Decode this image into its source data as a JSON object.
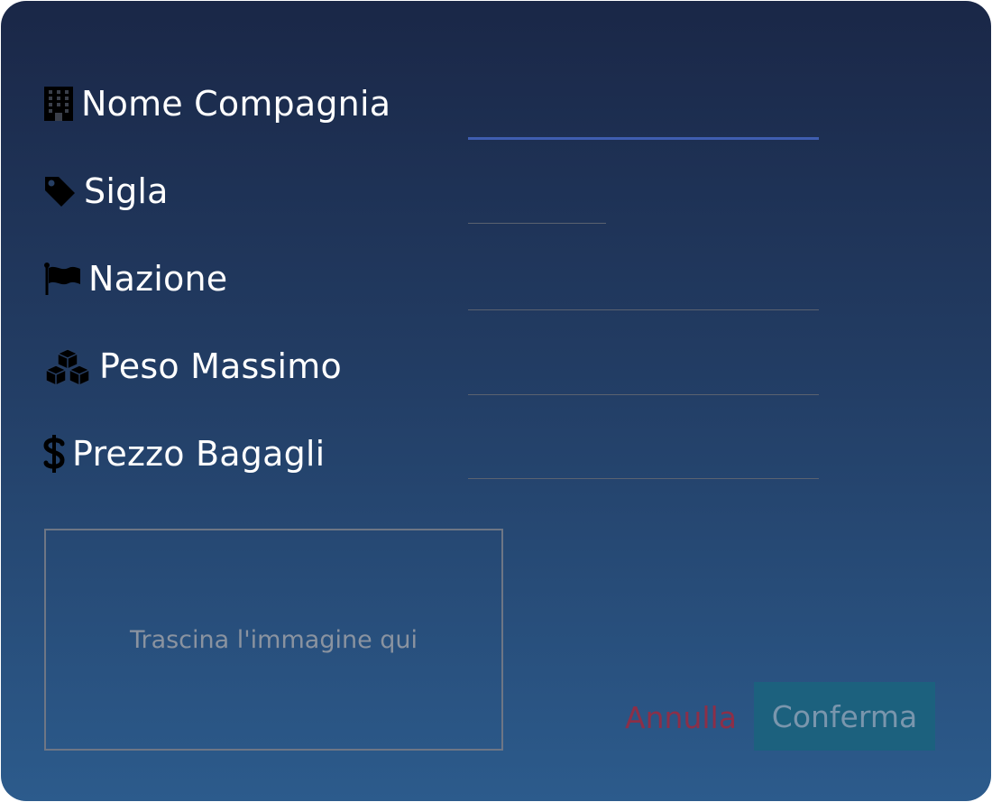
{
  "form": {
    "fields": [
      {
        "icon": "building-icon",
        "label": "Nome Compagnia",
        "value": ""
      },
      {
        "icon": "tag-icon",
        "label": "Sigla",
        "value": ""
      },
      {
        "icon": "flag-icon",
        "label": "Nazione",
        "value": ""
      },
      {
        "icon": "cubes-icon",
        "label": "Peso Massimo",
        "value": ""
      },
      {
        "icon": "dollar-icon",
        "label": "Prezzo Bagagli",
        "value": ""
      }
    ],
    "dropzone_text": "Trascina l'immagine qui",
    "cancel_label": "Annulla",
    "confirm_label": "Conferma"
  },
  "colors": {
    "focus_underline": "#3f5eb0",
    "cancel_text": "#8c2f48",
    "confirm_bg": "#1c617e",
    "confirm_text": "#7a96ad"
  }
}
